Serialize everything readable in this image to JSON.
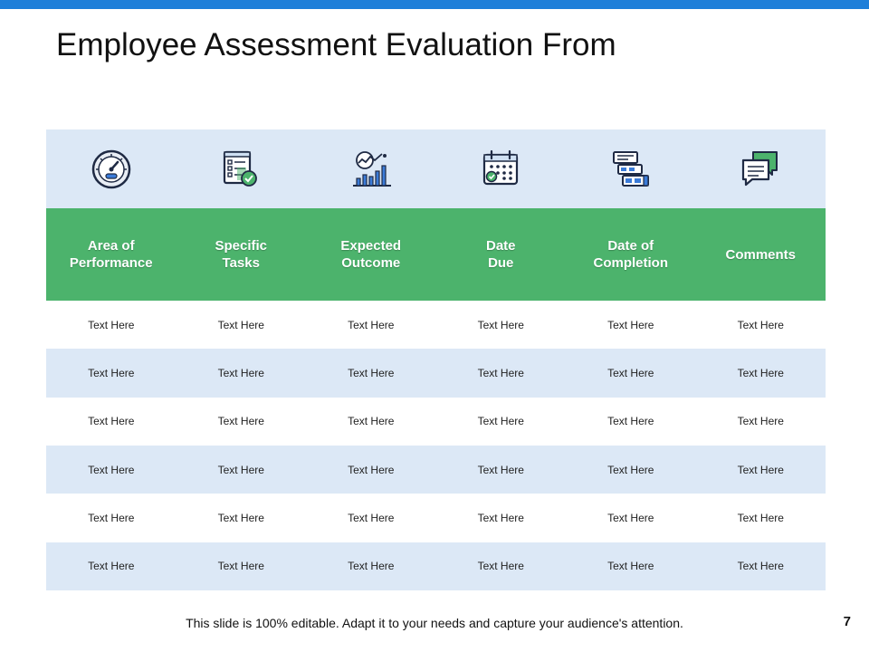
{
  "slide": {
    "title": "Employee Assessment Evaluation From",
    "footer": "This slide is 100% editable. Adapt it to your needs and capture your audience's attention.",
    "page_number": "7",
    "colors": {
      "top_bar": "#1e7fd9",
      "header_green": "#4cb36c",
      "row_light_blue": "#dce8f6"
    }
  },
  "table": {
    "icons": [
      "speedometer-icon",
      "checklist-icon",
      "growth-chart-icon",
      "calendar-icon",
      "schedule-blocks-icon",
      "comments-icon"
    ],
    "headers": [
      "Area of\nPerformance",
      "Specific\nTasks",
      "Expected\nOutcome",
      "Date\nDue",
      "Date of\nCompletion",
      "Comments"
    ],
    "rows": [
      [
        "Text Here",
        "Text Here",
        "Text Here",
        "Text Here",
        "Text Here",
        "Text Here"
      ],
      [
        "Text Here",
        "Text Here",
        "Text Here",
        "Text Here",
        "Text Here",
        "Text Here"
      ],
      [
        "Text Here",
        "Text Here",
        "Text Here",
        "Text Here",
        "Text Here",
        "Text Here"
      ],
      [
        "Text Here",
        "Text Here",
        "Text Here",
        "Text Here",
        "Text Here",
        "Text Here"
      ],
      [
        "Text Here",
        "Text Here",
        "Text Here",
        "Text Here",
        "Text Here",
        "Text Here"
      ],
      [
        "Text Here",
        "Text Here",
        "Text Here",
        "Text Here",
        "Text Here",
        "Text Here"
      ]
    ]
  }
}
